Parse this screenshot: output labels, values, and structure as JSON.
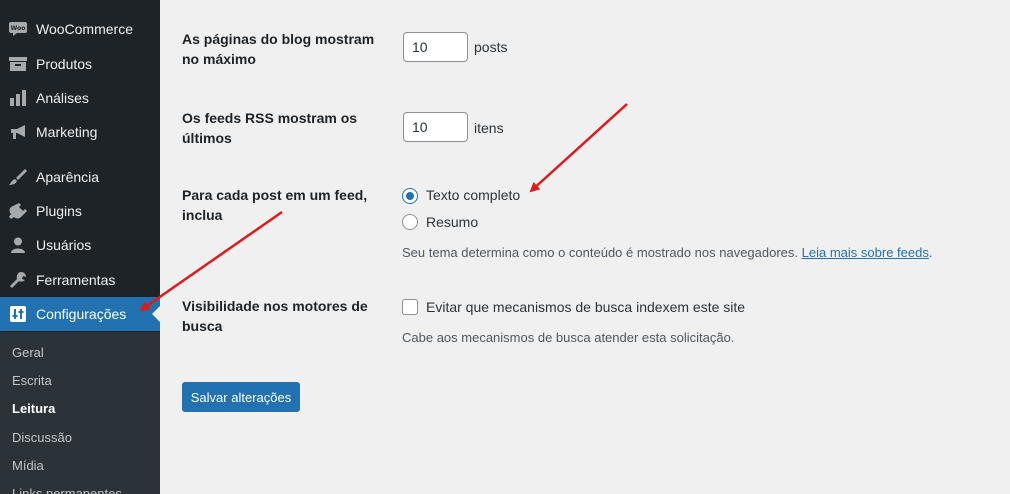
{
  "sidebar": {
    "items": [
      {
        "label": "WooCommerce",
        "icon": "woo-icon"
      },
      {
        "label": "Produtos",
        "icon": "archive-icon"
      },
      {
        "label": "Análises",
        "icon": "chart-bar-icon"
      },
      {
        "label": "Marketing",
        "icon": "megaphone-icon"
      },
      {
        "label": "Aparência",
        "icon": "brush-icon"
      },
      {
        "label": "Plugins",
        "icon": "plugin-icon"
      },
      {
        "label": "Usuários",
        "icon": "user-icon"
      },
      {
        "label": "Ferramentas",
        "icon": "wrench-icon"
      },
      {
        "label": "Configurações",
        "icon": "settings-sliders-icon",
        "active": true
      }
    ],
    "submenu": [
      "Geral",
      "Escrita",
      "Leitura",
      "Discussão",
      "Mídia",
      "Links permanentes"
    ],
    "current_submenu": "Leitura"
  },
  "form": {
    "posts_per_page": {
      "label": "As páginas do blog mostram no máximo",
      "value": "10",
      "unit": "posts"
    },
    "rss_items": {
      "label": "Os feeds RSS mostram os últimos",
      "value": "10",
      "unit": "itens"
    },
    "feed_content": {
      "label": "Para cada post em um feed, inclua",
      "options": [
        "Texto completo",
        "Resumo"
      ],
      "selected": "Texto completo",
      "description": "Seu tema determina como o conteúdo é mostrado nos navegadores.",
      "link_text": "Leia mais sobre feeds",
      "link_suffix": "."
    },
    "search_visibility": {
      "label": "Visibilidade nos motores de busca",
      "checkbox_label": "Evitar que mecanismos de busca indexem este site",
      "checked": false,
      "description": "Cabe aos mecanismos de busca atender esta solicitação."
    },
    "save_label": "Salvar alterações"
  },
  "colors": {
    "accent": "#2271b1",
    "sidebar_bg": "#1d2327",
    "annotation_arrow": "#e0191b"
  }
}
